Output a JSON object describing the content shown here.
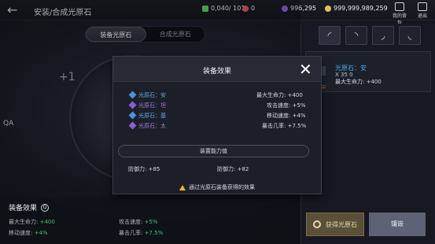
{
  "header": {
    "title": "安装/合成光原石",
    "currencies": [
      {
        "name": "energy",
        "value": "0,040/ 101",
        "color": "#5fd36b"
      },
      {
        "name": "orb",
        "value": "0",
        "color": "#e25b5b"
      },
      {
        "name": "gem",
        "value": "996,295",
        "color": "#8a63e6"
      },
      {
        "name": "coin",
        "value": "999,999,989,259",
        "color": "#e1c15a"
      }
    ],
    "bag_label": "我的背包",
    "exit_label": "退出"
  },
  "tabs": [
    {
      "label": "装备光原石",
      "active": true
    },
    {
      "label": "合成光原石",
      "active": false
    }
  ],
  "left": {
    "plus_label": "+1",
    "qa_label": "QA"
  },
  "right": {
    "slot_icons": [
      "slot-1-icon",
      "slot-2-icon",
      "slot-3-icon",
      "slot-4-icon"
    ],
    "card": {
      "name": "光原石：安",
      "stats": "X  35      0",
      "desc": "最大生命力: +400",
      "tag": "中"
    },
    "get_button": "获得光原石",
    "inlay_button": "镶嵌"
  },
  "bottom": {
    "title": "装备效果",
    "stats": [
      {
        "label": "最大生命力:",
        "value": "+400"
      },
      {
        "label": "攻击速度:",
        "value": "+5%"
      },
      {
        "label": "移动速度:",
        "value": "+4%"
      },
      {
        "label": "暴击几率:",
        "value": "+7.5%"
      }
    ]
  },
  "dialog": {
    "title": "装备效果",
    "gems": [
      {
        "label": "光原石：安",
        "color": "#4d8fe0"
      },
      {
        "label": "光原石：坦",
        "color": "#8b5cd6"
      },
      {
        "label": "光原石：基",
        "color": "#4d8fe0"
      },
      {
        "label": "光原石：太",
        "color": "#8b5cd6"
      }
    ],
    "stats": [
      "最大生命力: +400",
      "攻击速度: +5%",
      "移动速度: +4%",
      "暴击几率: +7.5%"
    ],
    "section_title": "装置能力值",
    "defense_left": "防御力: +85",
    "defense_right": "防御力: +82",
    "hint": "通过光原石装备获得的效果"
  }
}
